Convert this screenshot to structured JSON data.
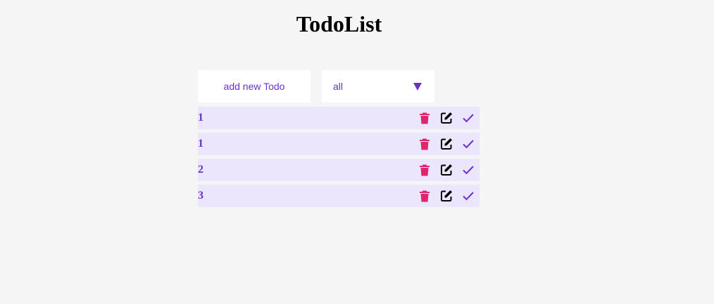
{
  "page": {
    "title": "TodoList"
  },
  "controls": {
    "add_label": "add new Todo",
    "filter_value": "all"
  },
  "todos": [
    {
      "text": "1"
    },
    {
      "text": "1"
    },
    {
      "text": "2"
    },
    {
      "text": "3"
    }
  ],
  "icons": {
    "delete": "trash-icon",
    "edit": "edit-icon",
    "complete": "check-icon"
  },
  "colors": {
    "accent": "#6a32c9",
    "delete": "#e0256c",
    "row_bg": "#ebe6fc",
    "page_bg": "#f5f5f5"
  }
}
